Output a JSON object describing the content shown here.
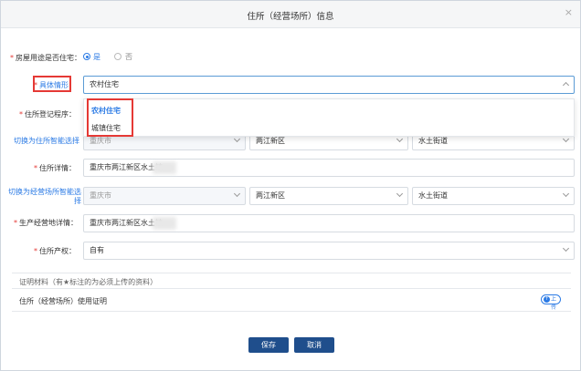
{
  "dialog": {
    "title": "住所（经营场所）信息",
    "close_icon": "close-icon"
  },
  "form": {
    "house_use": {
      "label": "房屋用途是否住宅：",
      "options": [
        "是",
        "否"
      ],
      "selected": "是"
    },
    "specific_case": {
      "label": "具体情形：",
      "value": "农村住宅",
      "dropdown_options": [
        "农村住宅",
        "城镇住宅"
      ],
      "highlighted_option": "农村住宅"
    },
    "registration_procedure": {
      "label": "住所登记程序："
    },
    "address_smart_link": {
      "label": "切换为住所智能选择",
      "city": "重庆市",
      "district": "两江新区",
      "street": "水土街道"
    },
    "address_detail": {
      "label": "住所详情：",
      "value": "重庆市两江新区水土镇"
    },
    "business_smart_link": {
      "label": "切换为经营场所智能选择",
      "city": "重庆市",
      "district": "两江新区",
      "street": "水土街道"
    },
    "business_detail": {
      "label": "生产经营地详情：",
      "value": "重庆市两江新区水土镇"
    },
    "property_right": {
      "label": "住所产权：",
      "value": "自有"
    }
  },
  "proof_section": {
    "title": "证明材料（有★标注的为必须上传的资料）",
    "item_label": "住所（经营场所）使用证明",
    "upload_label": "上传"
  },
  "buttons": {
    "save": "保存",
    "cancel": "取消"
  },
  "colors": {
    "accent": "#2c7be5",
    "required": "#e53935",
    "primary_button": "#1f4e8c"
  }
}
